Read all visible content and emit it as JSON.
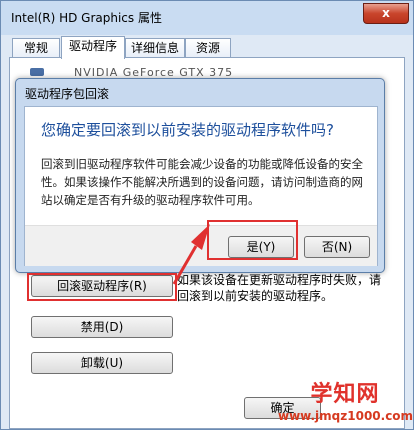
{
  "window": {
    "title": "Intel(R) HD Graphics 属性",
    "close_glyph": "x"
  },
  "tabs": [
    {
      "label": "常规",
      "selected": false
    },
    {
      "label": "驱动程序",
      "selected": true
    },
    {
      "label": "详细信息",
      "selected": false
    },
    {
      "label": "资源",
      "selected": false
    }
  ],
  "device": {
    "name": "NVIDIA GeForce GTX 375"
  },
  "panel": {
    "rollback_label": "回滚驱动程序(R)",
    "rollback_description": "如果该设备在更新驱动程序时失败，请回滚到以前安装的驱动程序。",
    "disable_label": "禁用(D)",
    "uninstall_label": "卸载(U)",
    "ok_label": "确定"
  },
  "dialog": {
    "title": "驱动程序包回滚",
    "question": "您确定要回滚到以前安装的驱动程序软件吗?",
    "detail": "回滚到旧驱动程序软件可能会减少设备的功能或降低设备的安全性。如果该操作不能解决所遇到的设备问题，请访问制造商的网站以确定是否有升级的驱动程序软件可用。",
    "yes_label": "是(Y)",
    "no_label": "否(N)"
  },
  "colors": {
    "annotation": "#e03030",
    "question_text": "#1d4f9c"
  },
  "watermark": {
    "name": "学知网",
    "site": "www.jmqz1000.com"
  }
}
